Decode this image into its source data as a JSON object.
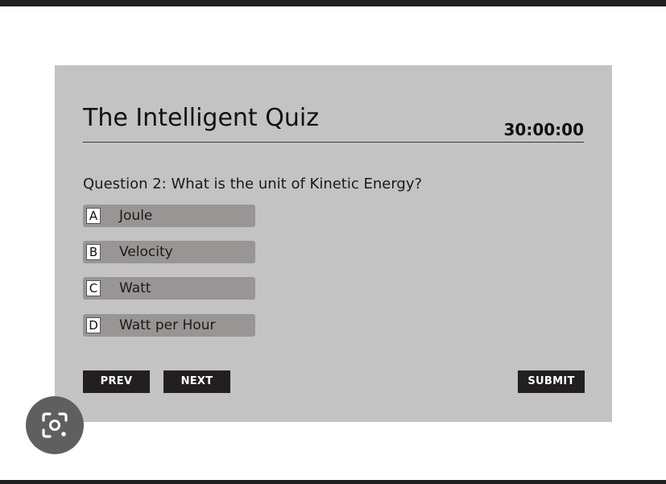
{
  "quiz": {
    "title": "The Intelligent Quiz",
    "timer": "30:00:00",
    "question": "Question 2: What is the unit of Kinetic Energy?",
    "options": [
      {
        "letter": "A",
        "label": "Joule"
      },
      {
        "letter": "B",
        "label": "Velocity"
      },
      {
        "letter": "C",
        "label": "Watt"
      },
      {
        "letter": "D",
        "label": "Watt per Hour"
      }
    ],
    "buttons": {
      "prev": "PREV",
      "next": "NEXT",
      "submit": "SUBMIT"
    }
  },
  "overlay": {
    "icon": "lens-search-icon"
  },
  "colors": {
    "panel": "#c3c3c3",
    "option_bg": "#9a9595",
    "button_bg": "#231f20",
    "frame_bars": "#1f1f1f"
  }
}
